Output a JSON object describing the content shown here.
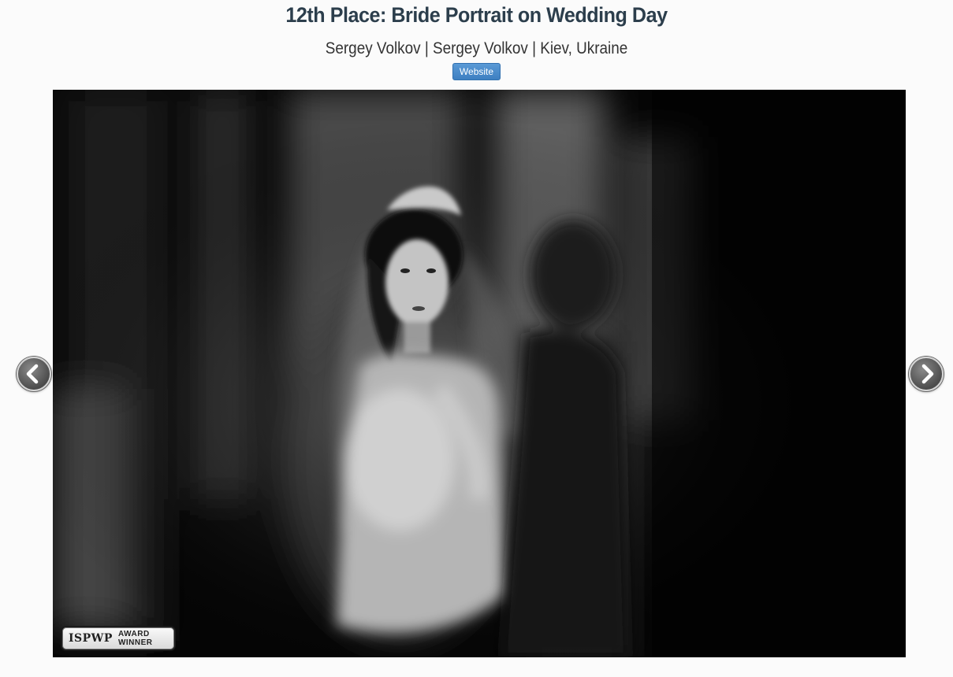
{
  "header": {
    "title": "12th Place: Bride Portrait on Wedding Day",
    "byline": "Sergey Volkov | Sergey Volkov | Kiev, Ukraine",
    "website_label": "Website"
  },
  "photo": {
    "badge_logo": "ISPWP",
    "badge_line1": "AWARD",
    "badge_line2": "WINNER"
  },
  "nav": {
    "prev_icon": "chevron-left-icon",
    "next_icon": "chevron-right-icon"
  },
  "colors": {
    "title": "#2c3e4c",
    "button": "#4a8bcc",
    "background": "#fbfbfb"
  }
}
